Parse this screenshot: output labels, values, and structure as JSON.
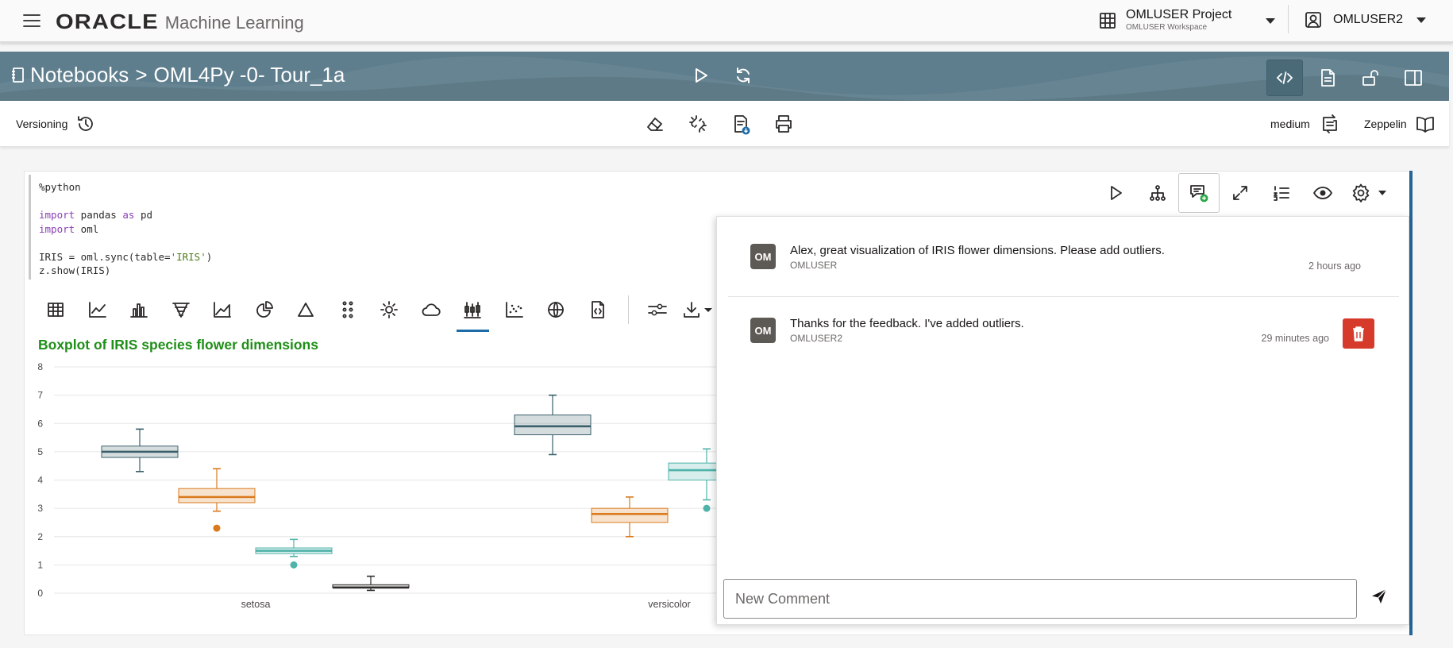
{
  "header": {
    "brand_oracle": "ORACLE",
    "brand_product": "Machine Learning",
    "project_name": "OMLUSER Project",
    "project_workspace": "OMLUSER Workspace",
    "user_name": "OMLUSER2"
  },
  "banner": {
    "breadcrumb_root": "Notebooks",
    "breadcrumb_separator": ">",
    "notebook_name": "OML4Py -0- Tour_1a"
  },
  "toolbar": {
    "versioning_label": "Versioning",
    "size_label": "medium",
    "interpreter_label": "Zeppelin"
  },
  "code": {
    "line1": "%python",
    "line3_kw": "import",
    "line3_a": " pandas ",
    "line3_kw2": "as",
    "line3_b": " pd",
    "line4_kw": "import",
    "line4_a": " oml",
    "line6_a": "IRIS = oml.sync(table=",
    "line6_str": "'IRIS'",
    "line6_b": ")",
    "line7": "z.show(IRIS)"
  },
  "chart_data": {
    "type": "boxplot",
    "title": "Boxplot of IRIS species flower dimensions",
    "ylim": [
      0,
      8
    ],
    "yticks": [
      "0",
      "1",
      "2",
      "3",
      "4",
      "5",
      "6",
      "7",
      "8"
    ],
    "categories": [
      "setosa",
      "versicolor"
    ],
    "colors": [
      "#3a5f6b",
      "#d97a1c",
      "#4fb3aa",
      "#2d2b29"
    ],
    "boxes": [
      {
        "category": "setosa",
        "color": "#3a5f6b",
        "min": 4.3,
        "q1": 4.8,
        "median": 5.0,
        "q3": 5.2,
        "max": 5.8,
        "outliers": []
      },
      {
        "category": "setosa",
        "color": "#d97a1c",
        "min": 2.9,
        "q1": 3.2,
        "median": 3.4,
        "q3": 3.7,
        "max": 4.4,
        "outliers": [
          2.3
        ]
      },
      {
        "category": "setosa",
        "color": "#4fb3aa",
        "min": 1.3,
        "q1": 1.4,
        "median": 1.5,
        "q3": 1.6,
        "max": 1.9,
        "outliers": [
          1.0
        ]
      },
      {
        "category": "setosa",
        "color": "#2d2b29",
        "min": 0.1,
        "q1": 0.2,
        "median": 0.2,
        "q3": 0.3,
        "max": 0.6,
        "outliers": []
      },
      {
        "category": "versicolor",
        "color": "#3a5f6b",
        "min": 4.9,
        "q1": 5.6,
        "median": 5.9,
        "q3": 6.3,
        "max": 7.0,
        "outliers": []
      },
      {
        "category": "versicolor",
        "color": "#d97a1c",
        "min": 2.0,
        "q1": 2.5,
        "median": 2.8,
        "q3": 3.0,
        "max": 3.4,
        "outliers": []
      },
      {
        "category": "versicolor",
        "color": "#4fb3aa",
        "min": 3.3,
        "q1": 4.0,
        "median": 4.35,
        "q3": 4.6,
        "max": 5.1,
        "outliers": [
          3.0
        ]
      }
    ]
  },
  "comments": {
    "items": [
      {
        "initials": "OM",
        "text": "Alex, great visualization of IRIS flower dimensions. Please add outliers.",
        "user": "OMLUSER",
        "time": "2 hours ago"
      },
      {
        "initials": "OM",
        "text": "Thanks for the feedback. I've added outliers.",
        "user": "OMLUSER2",
        "time": "29 minutes ago"
      }
    ],
    "new_placeholder": "New Comment"
  }
}
